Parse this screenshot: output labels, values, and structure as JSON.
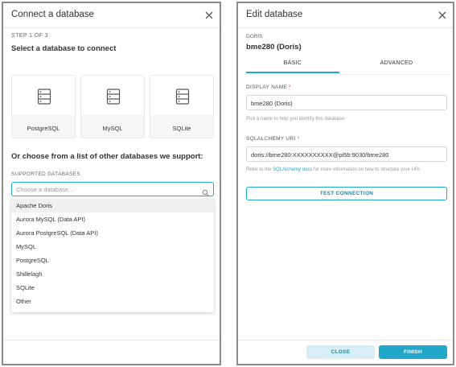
{
  "connect_modal": {
    "title": "Connect a database",
    "step": "STEP 1 OF 3",
    "heading": "Select a database to connect",
    "cards": [
      {
        "label": "PostgreSQL",
        "icon": "database-server-icon"
      },
      {
        "label": "MySQL",
        "icon": "database-server-icon"
      },
      {
        "label": "SQLite",
        "icon": "database-server-icon"
      }
    ],
    "other_heading": "Or choose from a list of other databases we support:",
    "supported_label": "SUPPORTED DATABASES",
    "search": {
      "placeholder": "Choose a database...",
      "value": ""
    },
    "dropdown_options": [
      "Apache Doris",
      "Aurora MySQL (Data API)",
      "Aurora PostgreSQL (Data API)",
      "MySQL",
      "PostgreSQL",
      "Shillelagh",
      "SQLite",
      "Other"
    ]
  },
  "edit_modal": {
    "title": "Edit database",
    "db_type": "DORIS",
    "db_name": "bme280 (Doris)",
    "tabs": [
      {
        "label": "BASIC",
        "active": true
      },
      {
        "label": "ADVANCED",
        "active": false
      }
    ],
    "display_name": {
      "label": "DISPLAY NAME",
      "required_marker": "*",
      "value": "bme280 (Doris)",
      "helper": "Pick a name to help you identify this database."
    },
    "sqlalchemy_uri": {
      "label": "SQLALCHEMY URI",
      "required_marker": "*",
      "value": "doris://bme280:XXXXXXXXXX@pi5b:9030/bme280",
      "helper_prefix": "Refer to the ",
      "helper_link": "SQLAlchemy docs",
      "helper_suffix": " for more information on how to structure your URI."
    },
    "test_connection": "TEST CONNECTION",
    "close_button": "CLOSE",
    "finish_button": "FINISH"
  },
  "colors": {
    "accent": "#20a7c9",
    "required": "#e04355",
    "border": "#8a8a8a"
  }
}
